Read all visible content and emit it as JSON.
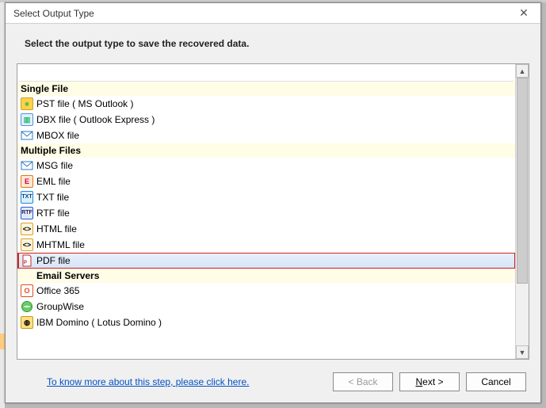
{
  "window": {
    "title": "Select Output Type",
    "close_glyph": "✕"
  },
  "instruction": "Select the output type to save the recovered data.",
  "groups": {
    "single": "Single File",
    "multiple": "Multiple Files",
    "servers": "Email Servers"
  },
  "items": {
    "pst": "PST file ( MS Outlook )",
    "dbx": "DBX file ( Outlook Express )",
    "mbox": "MBOX file",
    "msg": "MSG file",
    "eml": "EML file",
    "txt": "TXT file",
    "rtf": "RTF file",
    "html": "HTML file",
    "mhtml": "MHTML file",
    "pdf": "PDF file",
    "o365": "Office 365",
    "gw": "GroupWise",
    "domino": "IBM Domino ( Lotus Domino )"
  },
  "footer": {
    "link": "To know more about this step, please click here.",
    "back": "< Back",
    "next": "Next >",
    "cancel": "Cancel"
  },
  "scroll": {
    "up_glyph": "▲",
    "down_glyph": "▼"
  }
}
